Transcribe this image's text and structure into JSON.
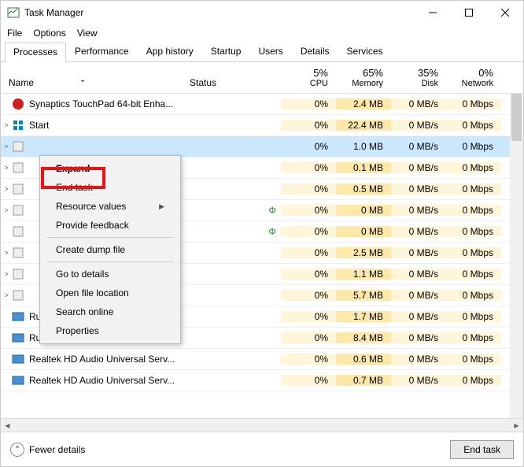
{
  "window": {
    "title": "Task Manager"
  },
  "menubar": [
    "File",
    "Options",
    "View"
  ],
  "tabs": [
    "Processes",
    "Performance",
    "App history",
    "Startup",
    "Users",
    "Details",
    "Services"
  ],
  "active_tab": 0,
  "columns": {
    "name": "Name",
    "status": "Status",
    "cpu": {
      "pct": "5%",
      "label": "CPU"
    },
    "memory": {
      "pct": "65%",
      "label": "Memory"
    },
    "disk": {
      "pct": "35%",
      "label": "Disk"
    },
    "network": {
      "pct": "0%",
      "label": "Network"
    }
  },
  "rows": [
    {
      "exp": "",
      "name": "Synaptics TouchPad 64-bit Enha...",
      "cpu": "0%",
      "mem": "2.4 MB",
      "disk": "0 MB/s",
      "net": "0 Mbps",
      "leaf": false,
      "icon": "syn"
    },
    {
      "exp": ">",
      "name": "Start",
      "cpu": "0%",
      "mem": "22.4 MB",
      "disk": "0 MB/s",
      "net": "0 Mbps",
      "leaf": false,
      "icon": "win",
      "selected": false
    },
    {
      "exp": ">",
      "name": "",
      "cpu": "0%",
      "mem": "1.0 MB",
      "disk": "0 MB/s",
      "net": "0 Mbps",
      "leaf": false,
      "icon": "app",
      "selected": true
    },
    {
      "exp": ">",
      "name": "",
      "cpu": "0%",
      "mem": "0.1 MB",
      "disk": "0 MB/s",
      "net": "0 Mbps",
      "leaf": false,
      "icon": "app"
    },
    {
      "exp": ">",
      "name": "",
      "cpu": "0%",
      "mem": "0.5 MB",
      "disk": "0 MB/s",
      "net": "0 Mbps",
      "leaf": false,
      "icon": "app"
    },
    {
      "exp": ">",
      "name": "",
      "cpu": "0%",
      "mem": "0 MB",
      "disk": "0 MB/s",
      "net": "0 Mbps",
      "leaf": true,
      "icon": "app"
    },
    {
      "exp": "",
      "name": "",
      "cpu": "0%",
      "mem": "0 MB",
      "disk": "0 MB/s",
      "net": "0 Mbps",
      "leaf": true,
      "icon": "app"
    },
    {
      "exp": ">",
      "name": "",
      "cpu": "0%",
      "mem": "2.5 MB",
      "disk": "0 MB/s",
      "net": "0 Mbps",
      "leaf": false,
      "icon": "app"
    },
    {
      "exp": ">",
      "name": "",
      "cpu": "0%",
      "mem": "1.1 MB",
      "disk": "0 MB/s",
      "net": "0 Mbps",
      "leaf": false,
      "icon": "app"
    },
    {
      "exp": ">",
      "name": "",
      "cpu": "0%",
      "mem": "5.7 MB",
      "disk": "0 MB/s",
      "net": "0 Mbps",
      "leaf": false,
      "icon": "app"
    },
    {
      "exp": "",
      "name": "Runtime Broker",
      "cpu": "0%",
      "mem": "1.7 MB",
      "disk": "0 MB/s",
      "net": "0 Mbps",
      "leaf": false,
      "icon": "svc"
    },
    {
      "exp": "",
      "name": "Runtime Broker",
      "cpu": "0%",
      "mem": "8.4 MB",
      "disk": "0 MB/s",
      "net": "0 Mbps",
      "leaf": false,
      "icon": "svc"
    },
    {
      "exp": "",
      "name": "Realtek HD Audio Universal Serv...",
      "cpu": "0%",
      "mem": "0.6 MB",
      "disk": "0 MB/s",
      "net": "0 Mbps",
      "leaf": false,
      "icon": "svc"
    },
    {
      "exp": "",
      "name": "Realtek HD Audio Universal Serv...",
      "cpu": "0%",
      "mem": "0.7 MB",
      "disk": "0 MB/s",
      "net": "0 Mbps",
      "leaf": false,
      "icon": "svc"
    }
  ],
  "context_menu": {
    "items": [
      {
        "label": "Expand",
        "bold": true
      },
      {
        "label": "End task",
        "highlight": true
      },
      {
        "label": "Resource values",
        "submenu": true
      },
      {
        "label": "Provide feedback"
      },
      {
        "sep": true
      },
      {
        "label": "Create dump file"
      },
      {
        "sep": true
      },
      {
        "label": "Go to details"
      },
      {
        "label": "Open file location"
      },
      {
        "label": "Search online"
      },
      {
        "label": "Properties"
      }
    ]
  },
  "footer": {
    "fewer": "Fewer details",
    "end_task": "End task"
  }
}
